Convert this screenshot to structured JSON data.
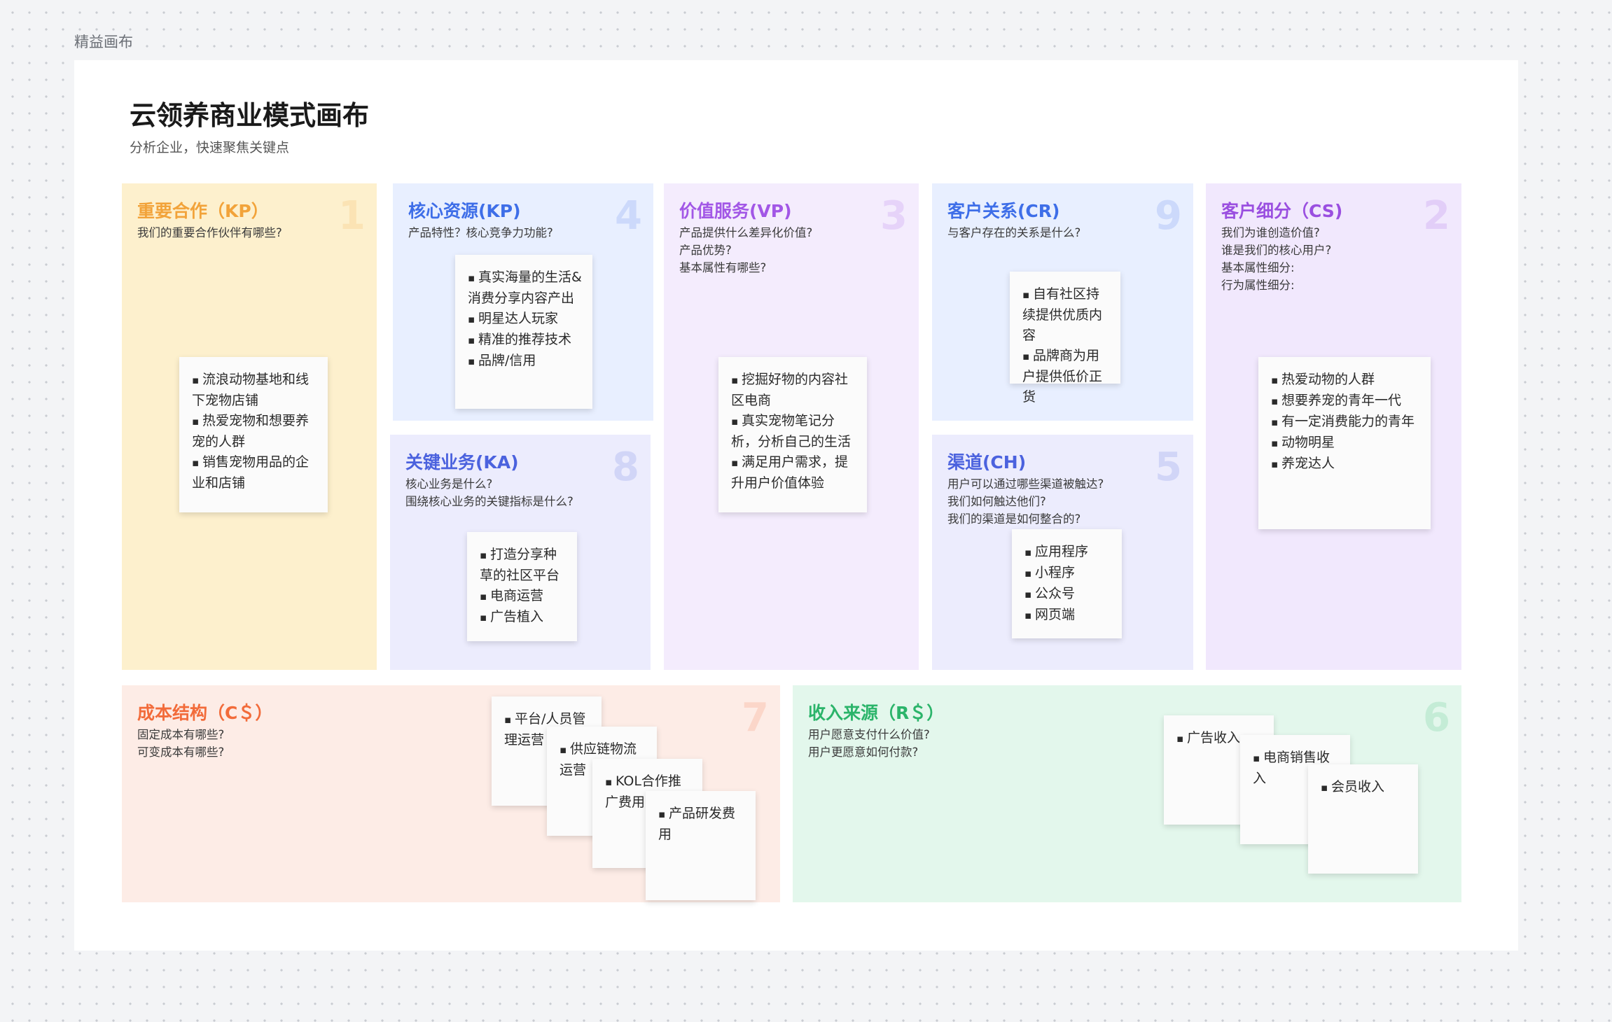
{
  "frame_label": "精益画布",
  "canvas": {
    "title": "云领养商业模式画布",
    "subtitle": "分析企业，快速聚焦关键点"
  },
  "colors": {
    "kp": "#fdf0cd",
    "kp_title": "#f2a33a",
    "res": "#e8efff",
    "res_title": "#3e6ee8",
    "ka": "#ececfd",
    "ka_title": "#4b62de",
    "vp": "#f4ecfd",
    "vp_title": "#a257e6",
    "cr": "#e8efff",
    "cr_title": "#3e6ee8",
    "ch": "#ececfd",
    "ch_title": "#4b62de",
    "cs": "#f1e8fd",
    "cs_title": "#9a4fe0",
    "cost": "#fdece6",
    "cost_title": "#f26b3a",
    "rev": "#e3f7ec",
    "rev_title": "#2bb46a"
  },
  "blocks": {
    "kp": {
      "title": "重要合作（KP）",
      "number": "1",
      "desc": "我们的重要合作伙伴有哪些?",
      "notes": [
        [
          "流浪动物基地和线下宠物店铺",
          "热爱宠物和想要养宠的人群",
          "销售宠物用品的企业和店铺"
        ]
      ]
    },
    "resources": {
      "title": "核心资源(KP)",
      "number": "4",
      "desc": "产品特性？核心竞争力功能?",
      "notes": [
        [
          "真实海量的生活&消费分享内容产出",
          "明星达人玩家",
          "精准的推荐技术",
          "品牌/信用"
        ]
      ]
    },
    "activities": {
      "title": "关键业务(KA)",
      "number": "8",
      "desc": "核心业务是什么?\n围绕核心业务的关键指标是什么?",
      "notes": [
        [
          "打造分享种草的社区平台",
          "电商运营",
          "广告植入"
        ]
      ]
    },
    "vp": {
      "title": "价值服务(VP)",
      "number": "3",
      "desc": "产品提供什么差异化价值?\n产品优势?\n基本属性有哪些?",
      "notes": [
        [
          "挖掘好物的内容社区电商",
          "真实宠物笔记分析，分析自己的生活",
          "满足用户需求，提升用户价值体验"
        ]
      ]
    },
    "cr": {
      "title": "客户关系(CR)",
      "number": "9",
      "desc": "与客户存在的关系是什么?",
      "notes": [
        [
          "自有社区持续提供优质内容",
          "品牌商为用户提供低价正货"
        ]
      ]
    },
    "channels": {
      "title": "渠道(CH)",
      "number": "5",
      "desc": "用户可以通过哪些渠道被触达?\n我们如何触达他们?\n我们的渠道是如何整合的?",
      "notes": [
        [
          "应用程序",
          "小程序",
          "公众号",
          "网页端"
        ]
      ]
    },
    "cs": {
      "title": "客户细分（CS)",
      "number": "2",
      "desc": "我们为谁创造价值?\n谁是我们的核心用户?\n基本属性细分:\n行为属性细分:",
      "notes": [
        [
          "热爱动物的人群",
          "想要养宠的青年一代",
          "有一定消费能力的青年",
          "动物明星",
          "养宠达人"
        ]
      ]
    },
    "cost": {
      "title": "成本结构（C＄）",
      "number": "7",
      "desc": "固定成本有哪些?\n可变成本有哪些?",
      "notes": [
        [
          "平台/人员管理运营"
        ],
        [
          "供应链物流运营"
        ],
        [
          "KOL合作推广费用"
        ],
        [
          "产品研发费用"
        ]
      ]
    },
    "revenue": {
      "title": "收入来源（R＄）",
      "number": "6",
      "desc": "用户愿意支付什么价值?\n用户更愿意如何付款?",
      "notes": [
        [
          "广告收入"
        ],
        [
          "电商销售收入"
        ],
        [
          "会员收入"
        ]
      ]
    }
  }
}
